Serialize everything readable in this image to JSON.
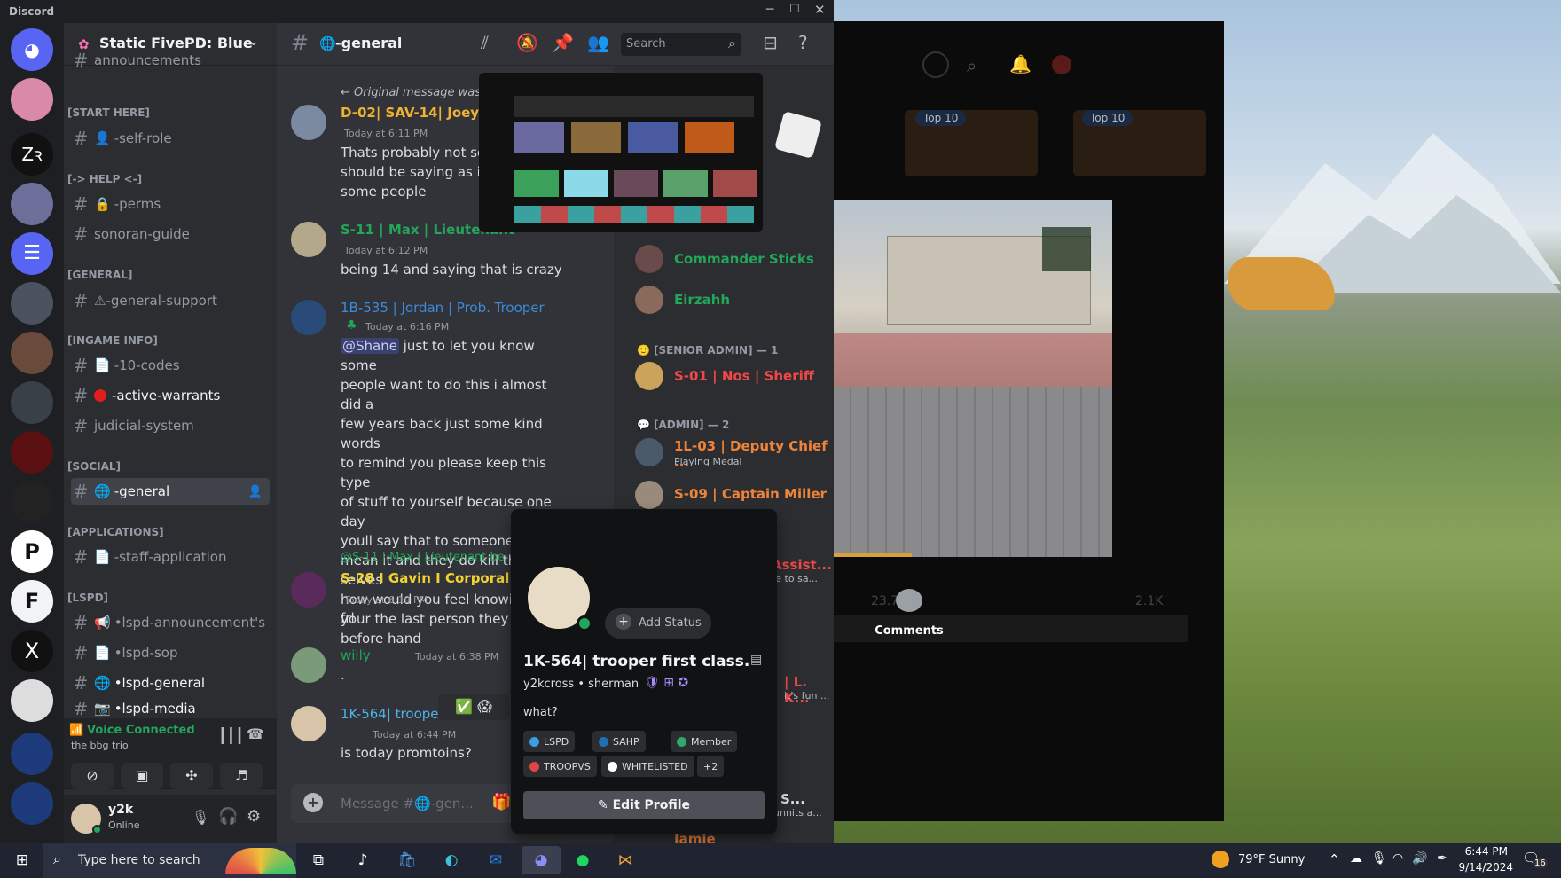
{
  "window": {
    "app_title": "Discord"
  },
  "server": {
    "name": "Static FivePD: Blue"
  },
  "channels": {
    "top_partial": "announcements",
    "categories": [
      {
        "label": "[START HERE]"
      },
      {
        "label": "[-> HELP <-]"
      },
      {
        "label": "[GENERAL]"
      },
      {
        "label": "[INGAME INFO]"
      },
      {
        "label": "[SOCIAL]"
      },
      {
        "label": "[APPLICATIONS]"
      },
      {
        "label": "[LSPD]"
      }
    ],
    "items": [
      {
        "label": "-self-role"
      },
      {
        "label": "-perms"
      },
      {
        "label": "sonoran-guide"
      },
      {
        "label": "⚠-general-support"
      },
      {
        "label": "-10-codes"
      },
      {
        "label": "-active-warrants"
      },
      {
        "label": "judicial-system"
      },
      {
        "label": "-general"
      },
      {
        "label": "-staff-application"
      },
      {
        "label": "•lspd-announcement's"
      },
      {
        "label": "•lspd-sop"
      },
      {
        "label": "•lspd-general"
      },
      {
        "label": "•lspd-media"
      }
    ]
  },
  "voice": {
    "status": "Voice Connected",
    "channel": "the bbg trio"
  },
  "user": {
    "name": "y2k",
    "status": "Online"
  },
  "chat": {
    "channel_name": "-general",
    "search_placeholder": "Search",
    "composer_placeholder": "Message #🌐-gen...",
    "messages": [
      {
        "reply": "Original message was d",
        "author": "D-02| SAV-14| Joeyxpk",
        "time": "Today at 6:11 PM",
        "lines": [
          "Thats probably not som",
          "should be saying as it m",
          "some people"
        ]
      },
      {
        "author": "S-11 | Max | Lieutenant",
        "time": "Today at 6:12 PM",
        "lines": [
          "being 14 and saying that is crazy"
        ]
      },
      {
        "author": "1B-535 | Jordan | Prob. Trooper",
        "time": "Today at 6:16 PM",
        "mention": "@Shane",
        "lines": [
          "just to let you know some",
          "people want to do this i almost did a",
          "few years back just some kind words",
          "to remind you please keep this type",
          "of stuff to yourself because one day",
          "youll say that to someone and not",
          "mean it and they do kill them selves",
          "how would you feel knowing that",
          "your the last person they spoke to",
          "before hand"
        ]
      },
      {
        "reply": "@S-11 | Max | Lieutenant bei",
        "author": "S-28 I Gavin I Corporal",
        "time": "Today at 6:19 PM",
        "lines": [
          "frl"
        ]
      },
      {
        "author": "willy",
        "time": "Today at 6:38 PM",
        "lines": [
          "."
        ]
      },
      {
        "author": "1K-564| troope",
        "time": "Today at 6:44 PM",
        "lines": [
          "is today promtoins?"
        ]
      }
    ]
  },
  "members": {
    "items": [
      {
        "name": "Commander Sticks"
      },
      {
        "name": "Eirzahh"
      }
    ],
    "senior_admin_header": "[SENIOR ADMIN] — 1",
    "senior_admin": {
      "name": "S-01 | Nos | Sheriff"
    },
    "admin_header": "[ADMIN] — 2",
    "admin": [
      {
        "name": "1L-03 | Deputy Chief ...",
        "activity": "Playing Medal"
      },
      {
        "name": "S-09 | Captain Miller"
      }
    ],
    "partial": [
      {
        "name": "Assist...",
        "sub": "re to sa..."
      },
      {
        "name": "| L. K...",
        "sub": "it's fun ..."
      },
      {
        "name": "S...",
        "sub": "unnits a..."
      },
      {
        "name": "Jamie"
      }
    ]
  },
  "popup": {
    "display_name": "1K-564| trooper first class.",
    "username": "y2kcross",
    "pronouns": "sherman",
    "add_status": "Add Status",
    "bio": "what?",
    "roles": [
      {
        "label": "LSPD",
        "color": "#3a9ee0"
      },
      {
        "label": "SAHP",
        "color": "#1f6fb5"
      },
      {
        "label": "Member",
        "color": "#2fa86a"
      },
      {
        "label": "TROOPVS",
        "color": "#e04545"
      },
      {
        "label": "WHITELISTED",
        "color": "#ffffff"
      }
    ],
    "more_roles": "+2",
    "edit_button": "Edit Profile"
  },
  "background_app": {
    "pills": [
      "Top 10",
      "Top 10"
    ],
    "comments_label": "Comments",
    "counts": [
      "23.7K",
      "2.1K"
    ]
  },
  "taskbar": {
    "search_placeholder": "Type here to search",
    "weather": "79°F  Sunny",
    "time": "6:44 PM",
    "date": "9/14/2024",
    "notification_count": "16"
  }
}
